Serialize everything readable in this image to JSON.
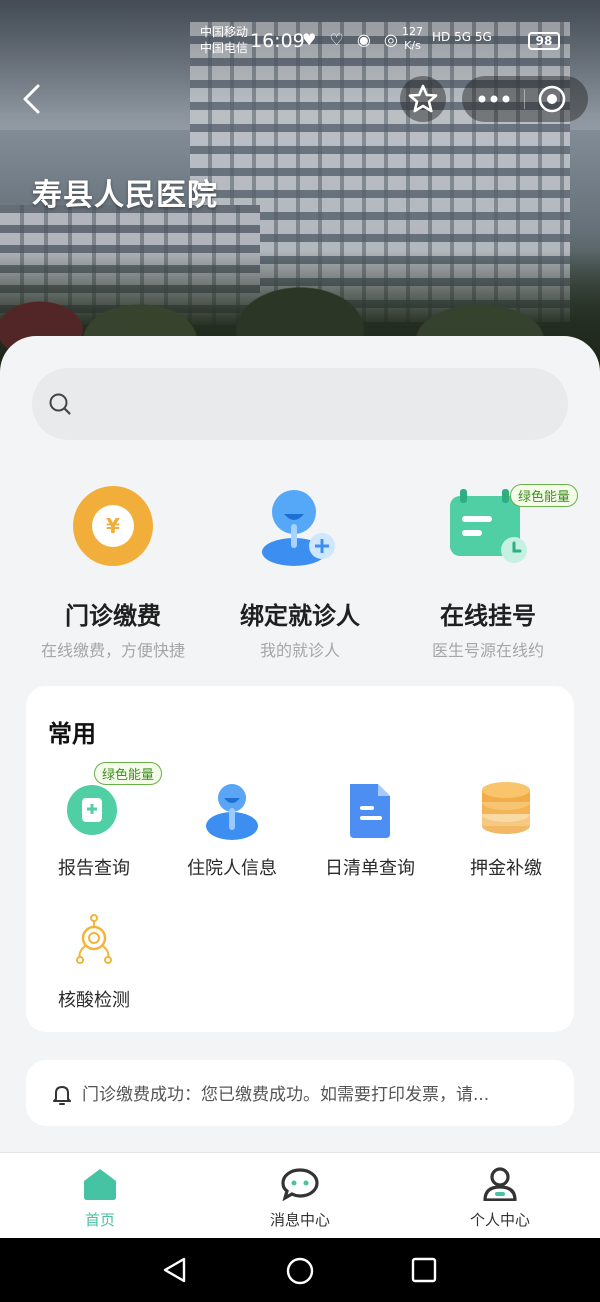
{
  "status_bar": {
    "carrier_1": "中国移动",
    "carrier_2": "中国电信",
    "time": "16:09",
    "speed_value": "127",
    "speed_unit": "K/s",
    "network": "HD 5G 5G",
    "battery": "98"
  },
  "header": {
    "hospital_name": "寿县人民医院"
  },
  "search": {
    "placeholder": ""
  },
  "features": [
    {
      "title": "门诊缴费",
      "subtitle": "在线缴费，方便快捷",
      "icon": "yuan-coin-icon",
      "color": "#f2ae3b"
    },
    {
      "title": "绑定就诊人",
      "subtitle": "我的就诊人",
      "icon": "add-patient-icon",
      "color": "#3c8ff0"
    },
    {
      "title": "在线挂号",
      "subtitle": "医生号源在线约",
      "icon": "calendar-register-icon",
      "color": "#4fcfa3",
      "badge": "绿色能量"
    }
  ],
  "common": {
    "title": "常用",
    "items": [
      {
        "label": "报告查询",
        "icon": "report-icon",
        "badge": "绿色能量"
      },
      {
        "label": "住院人信息",
        "icon": "inpatient-icon"
      },
      {
        "label": "日清单查询",
        "icon": "daily-list-icon"
      },
      {
        "label": "押金补缴",
        "icon": "deposit-coins-icon"
      },
      {
        "label": "核酸检测",
        "icon": "nucleic-test-icon"
      }
    ]
  },
  "notice": {
    "text": "门诊缴费成功：您已缴费成功。如需要打印发票，请..."
  },
  "tabbar": {
    "items": [
      {
        "label": "首页",
        "icon": "home-icon",
        "active": true
      },
      {
        "label": "消息中心",
        "icon": "message-icon",
        "active": false
      },
      {
        "label": "个人中心",
        "icon": "profile-icon",
        "active": false
      }
    ],
    "active_color": "#46c3a3",
    "inactive_color": "#333333"
  }
}
